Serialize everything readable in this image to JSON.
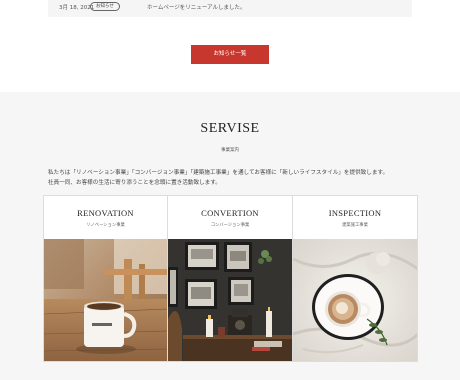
{
  "news": {
    "date": "3月 18, 2021",
    "badge": "お知らせ",
    "text": "ホームページをリニューアルしました。",
    "list_button": "お知らせ一覧"
  },
  "service": {
    "title": "SERVISE",
    "subtitle": "事業案内",
    "description_line1": "私たちは「リノベーション事業」「コンバージョン事業」「建築施工事業」を通してお客様に「新しいライフスタイル」を提供致します。",
    "description_line2": "社員一同、お客様の生活に寄り添うことを念頭に置き活動致します。",
    "cards": [
      {
        "title": "RENOVATION",
        "subtitle": "リノベーション事業",
        "photo": "coffee-cup-on-wooden-table"
      },
      {
        "title": "CONVERTION",
        "subtitle": "コンバージョン事業",
        "photo": "vintage-room-with-frames-and-candles"
      },
      {
        "title": "INSPECTION",
        "subtitle": "建築施工事業",
        "photo": "latte-cup-on-white-blanket"
      }
    ]
  },
  "colors": {
    "accent_red": "#c8372d",
    "section_background": "#f6f6f6"
  }
}
